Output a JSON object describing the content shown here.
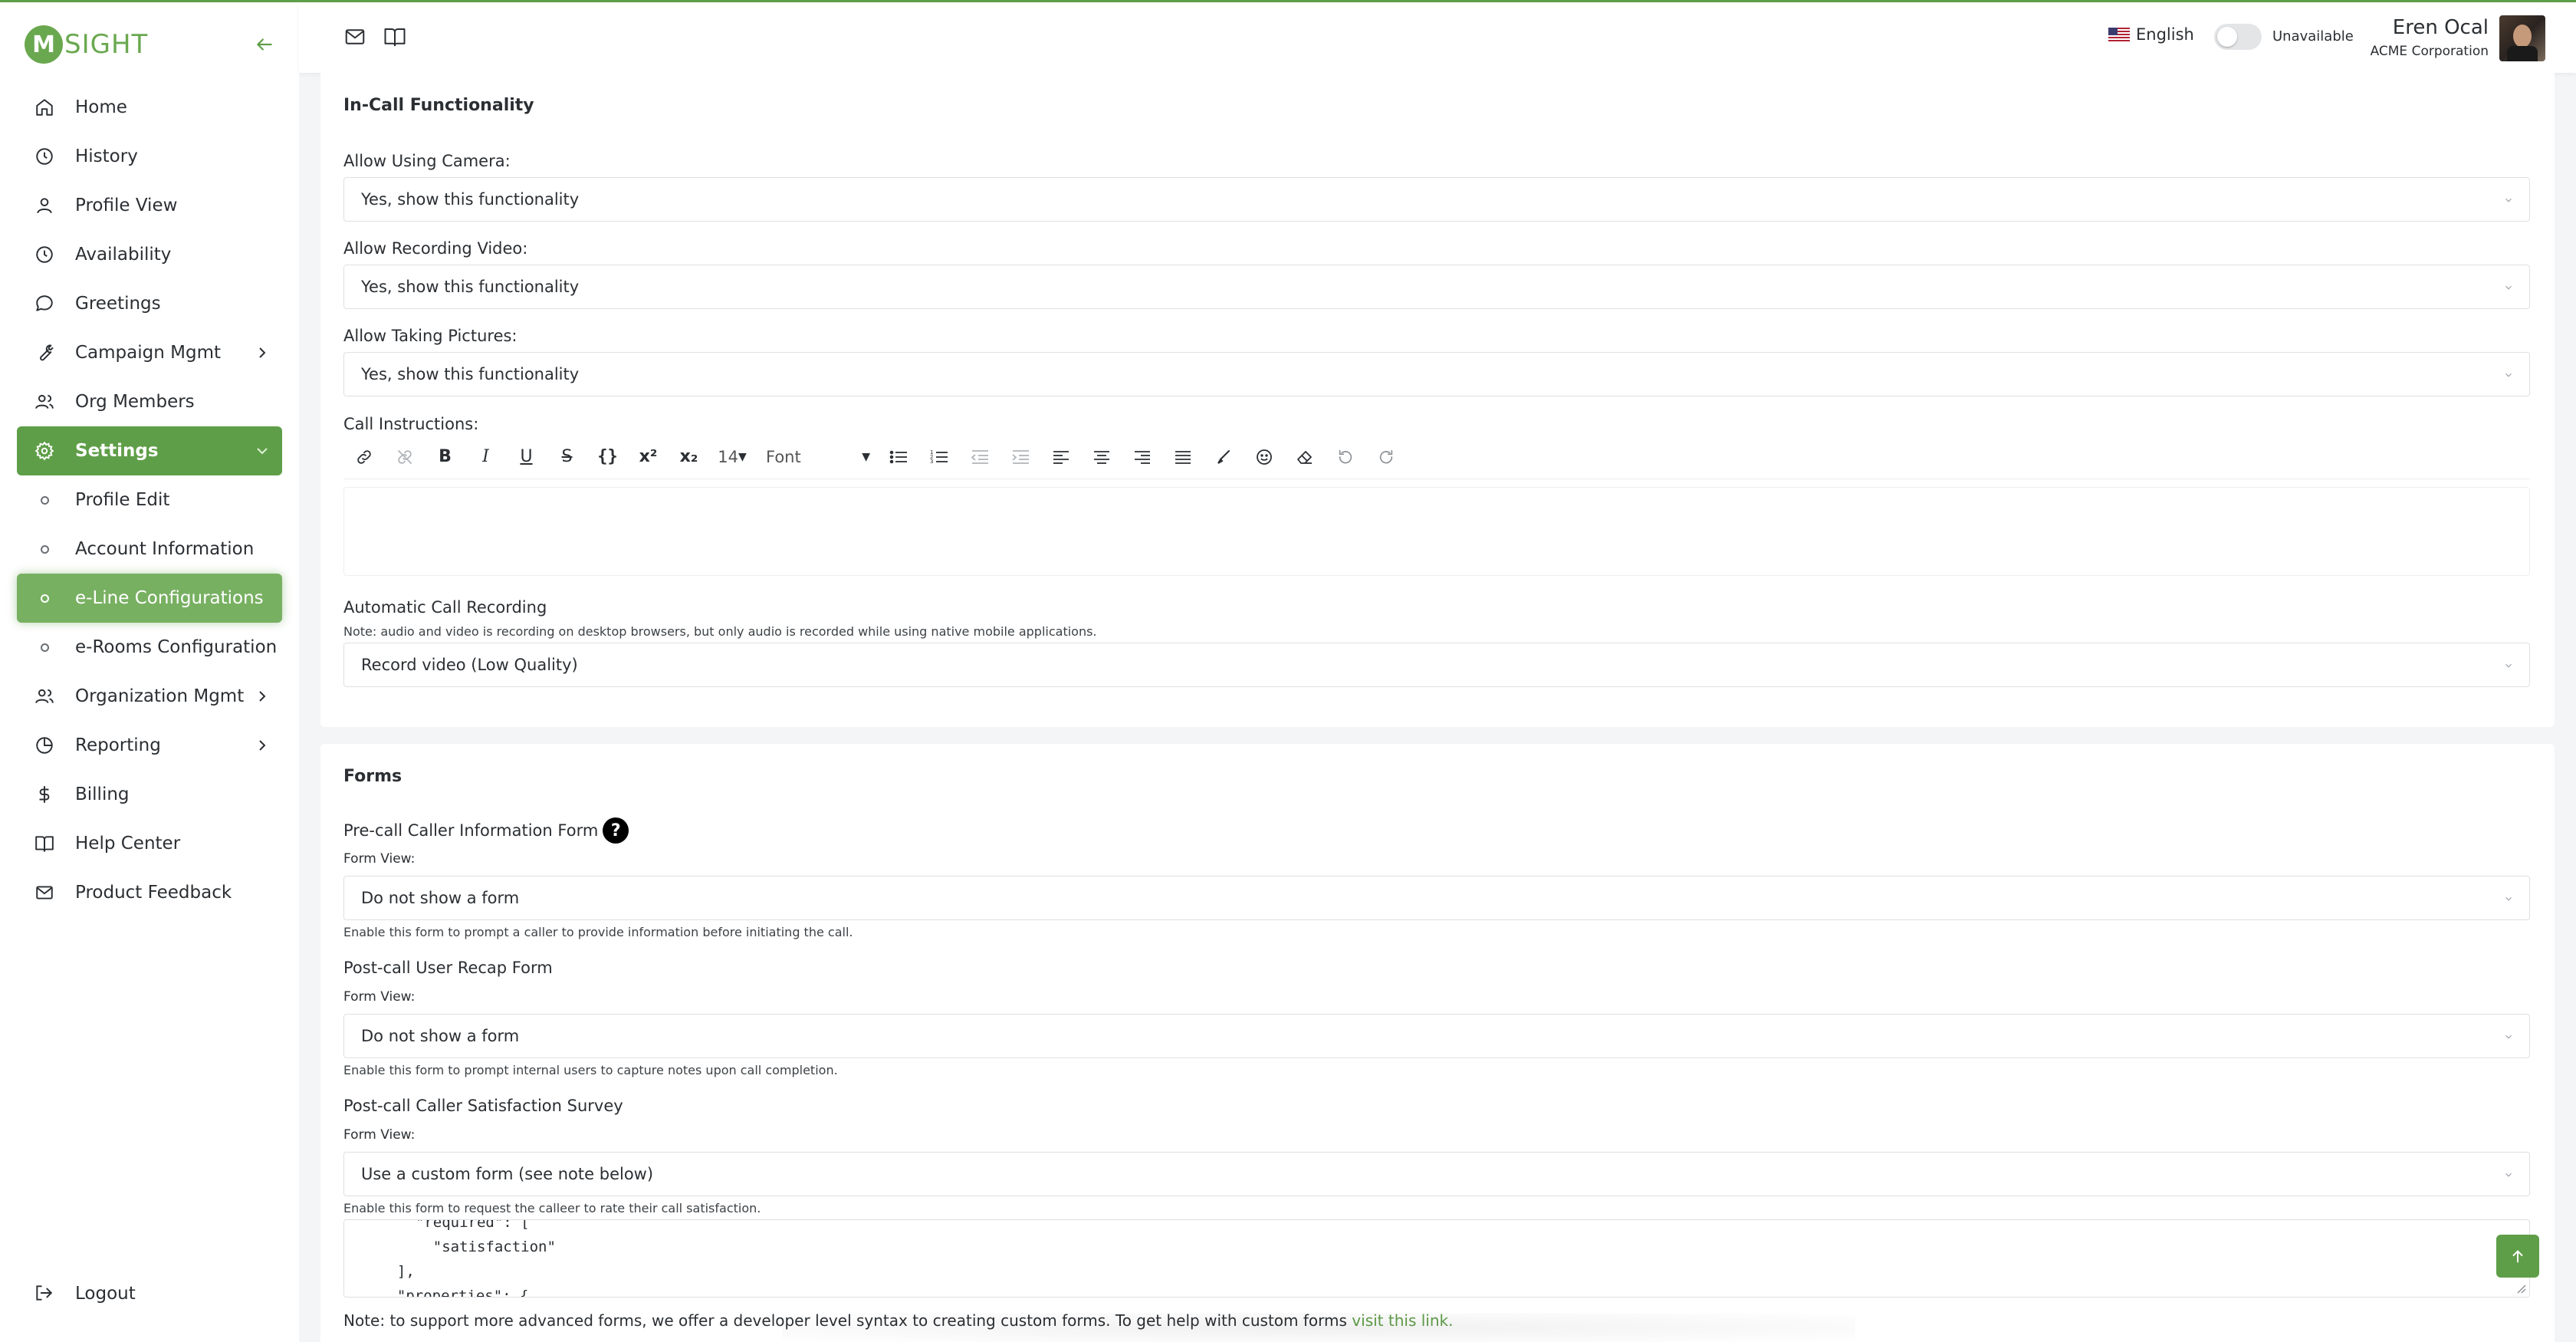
{
  "brand": {
    "mark": "M",
    "name": "SIGHT"
  },
  "sidebar": {
    "items": [
      {
        "label": "Home",
        "icon": "home-icon"
      },
      {
        "label": "History",
        "icon": "clock-icon"
      },
      {
        "label": "Profile View",
        "icon": "user-icon"
      },
      {
        "label": "Availability",
        "icon": "clock-icon"
      },
      {
        "label": "Greetings",
        "icon": "chat-icon"
      },
      {
        "label": "Campaign Mgmt",
        "icon": "wrench-icon"
      },
      {
        "label": "Org Members",
        "icon": "users-icon"
      },
      {
        "label": "Settings",
        "icon": "gear-icon"
      },
      {
        "label": "Profile Edit"
      },
      {
        "label": "Account Information"
      },
      {
        "label": "e-Line Configurations"
      },
      {
        "label": "e-Rooms Configuration"
      },
      {
        "label": "Organization Mgmt",
        "icon": "users-icon"
      },
      {
        "label": "Reporting",
        "icon": "pie-icon"
      },
      {
        "label": "Billing",
        "icon": "dollar-icon"
      },
      {
        "label": "Help Center",
        "icon": "book-icon"
      },
      {
        "label": "Product Feedback",
        "icon": "mail-icon"
      }
    ],
    "logout": "Logout"
  },
  "topbar": {
    "language": "English",
    "availability": "Unavailable",
    "user_name": "Eren Ocal",
    "user_org": "ACME Corporation"
  },
  "in_call": {
    "title": "In-Call Functionality",
    "camera_label": "Allow Using Camera:",
    "camera_value": "Yes, show this functionality",
    "recording_label": "Allow Recording Video:",
    "recording_value": "Yes, show this functionality",
    "pictures_label": "Allow Taking Pictures:",
    "pictures_value": "Yes, show this functionality",
    "instructions_label": "Call Instructions:",
    "font_size": "14",
    "font_name": "Font",
    "auto_label": "Automatic Call Recording",
    "auto_note": "Note: audio and video is recording on desktop browsers, but only audio is recorded while using native mobile applications.",
    "auto_value": "Record video (Low Quality)"
  },
  "forms": {
    "title": "Forms",
    "precall_label": "Pre-call Caller Information Form",
    "precall_view": "Form View:",
    "precall_value": "Do not show a form",
    "precall_hint": "Enable this form to prompt a caller to provide information before initiating the call.",
    "recap_label": "Post-call User Recap Form",
    "recap_view": "Form View:",
    "recap_value": "Do not show a form",
    "recap_hint": "Enable this form to prompt internal users to capture notes upon call completion.",
    "survey_label": "Post-call Caller Satisfaction Survey",
    "survey_view": "Form View:",
    "survey_value": "Use a custom form (see note below)",
    "survey_hint": "Enable this form to request the calleer to rate their call satisfaction.",
    "code_lines": [
      "  \"required\": [",
      "    \"satisfaction\"",
      "  ],",
      "  \"properties\": {"
    ],
    "footnote": "Note: to support more advanced forms, we offer a developer level syntax to creating custom forms. To get help with custom forms ",
    "footnote_link": "visit this link."
  }
}
